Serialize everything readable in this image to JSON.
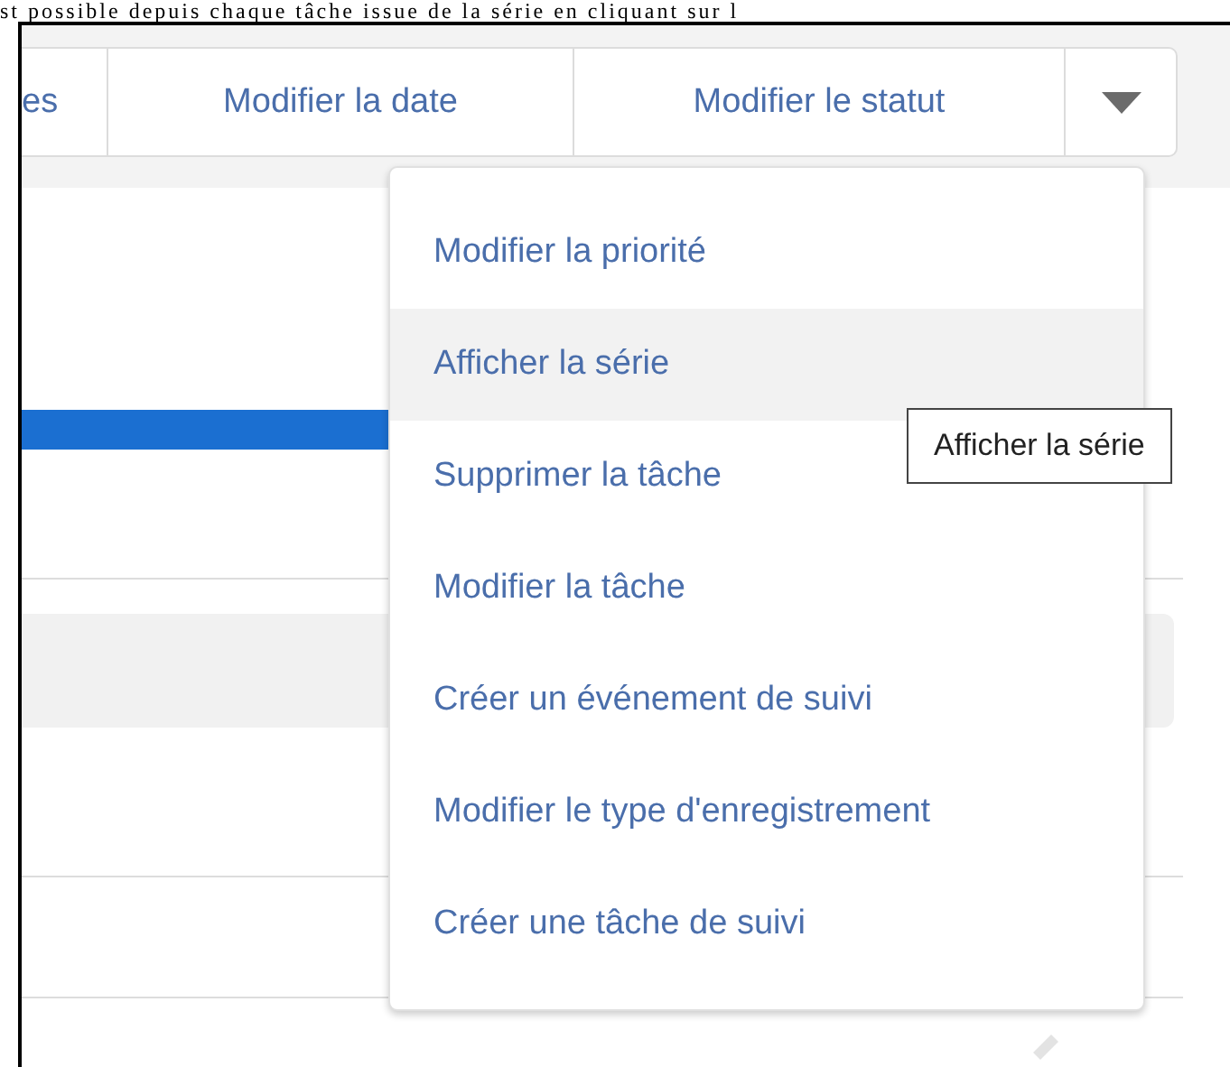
{
  "caption": "st possible depuis chaque tâche issue de la série en cliquant sur l",
  "toolbar": {
    "buttons": [
      {
        "label": "es"
      },
      {
        "label": "Modifier la date"
      },
      {
        "label": "Modifier le statut"
      }
    ],
    "menu_open": true
  },
  "menu": {
    "items": [
      {
        "label": "Modifier la priorité",
        "selected": false
      },
      {
        "label": "Afficher la série",
        "selected": true
      },
      {
        "label": "Supprimer la tâche",
        "selected": false
      },
      {
        "label": "Modifier la tâche",
        "selected": false
      },
      {
        "label": "Créer un événement de suivi",
        "selected": false
      },
      {
        "label": "Modifier le type d'enregistrement",
        "selected": false
      },
      {
        "label": "Créer une tâche de suivi",
        "selected": false
      }
    ]
  },
  "tooltip": {
    "text": "Afficher la série"
  }
}
